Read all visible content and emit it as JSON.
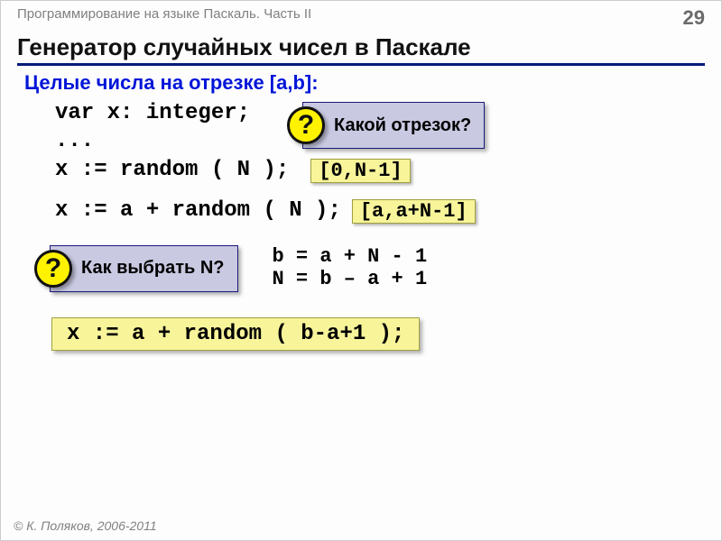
{
  "header": {
    "course": "Программирование на языке Паскаль. Часть II",
    "page": "29"
  },
  "title": "Генератор случайных чисел в Паскале",
  "subtitle": "Целые числа на отрезке [a,b]:",
  "code": {
    "l1": "var x: integer;",
    "l2": "...",
    "l3": "x := random ( N );",
    "l4": "x := a + random ( N );"
  },
  "callouts": {
    "q1": "Какой отрезок?",
    "q2": "Как выбрать N?"
  },
  "ranges": {
    "r1": "[0,N-1]",
    "r2": "[a,a+N-1]"
  },
  "eqs": {
    "e1": "b = a + N - 1",
    "e2": "N = b – a + 1"
  },
  "final": "x := a + random ( b-a+1 );",
  "qmark": "?",
  "footer": "© К. Поляков, 2006-2011"
}
